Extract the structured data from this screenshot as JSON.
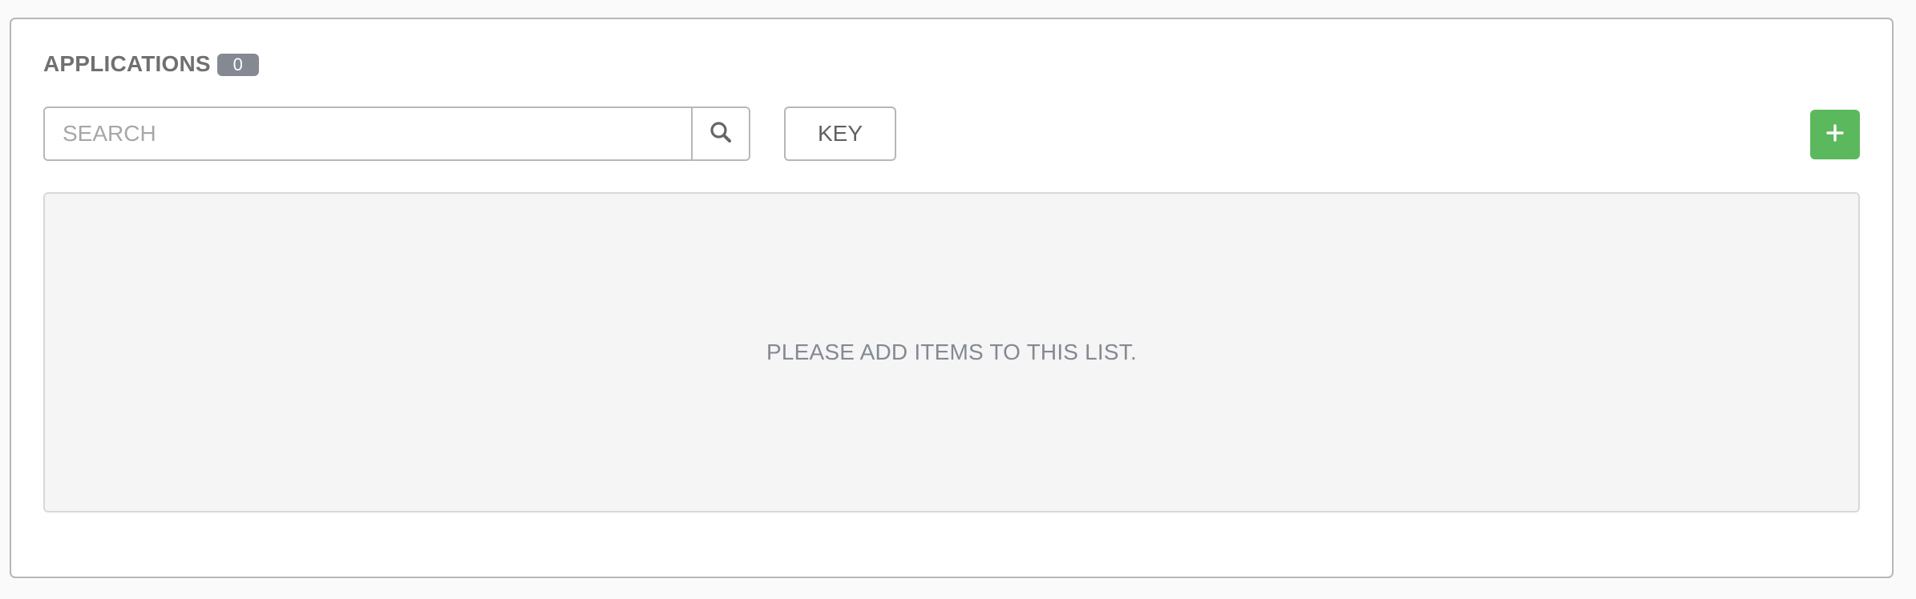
{
  "header": {
    "title": "APPLICATIONS",
    "count": "0"
  },
  "search": {
    "placeholder": "SEARCH",
    "value": "",
    "icon": "search-icon"
  },
  "toolbar": {
    "key_label": "KEY",
    "add_label": "+",
    "add_color": "#5cb85c"
  },
  "list": {
    "empty_message": "PLEASE ADD ITEMS TO THIS LIST."
  }
}
